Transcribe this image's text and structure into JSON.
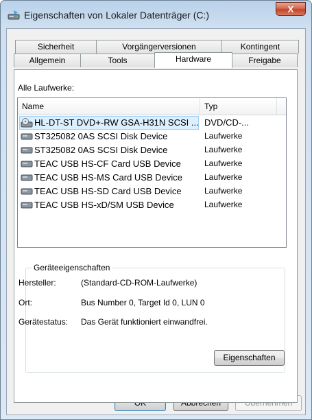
{
  "window": {
    "title": "Eigenschaften von Lokaler Datenträger (C:)",
    "close_label": "X"
  },
  "tabs_row1": [
    "Sicherheit",
    "Vorgängerversionen",
    "Kontingent"
  ],
  "tabs_row2": [
    "Allgemein",
    "Tools",
    "Hardware",
    "Freigabe"
  ],
  "active_tab": "Hardware",
  "drives_label": "Alle Laufwerke:",
  "list": {
    "columns": [
      "Name",
      "Typ"
    ],
    "rows": [
      {
        "name": "HL-DT-ST DVD+-RW GSA-H31N SCSI ...",
        "type": "DVD/CD-...",
        "icon": "dvd-drive-icon",
        "selected": true
      },
      {
        "name": "ST325082 0AS SCSI Disk Device",
        "type": "Laufwerke",
        "icon": "disk-drive-icon"
      },
      {
        "name": "ST325082 0AS SCSI Disk Device",
        "type": "Laufwerke",
        "icon": "disk-drive-icon"
      },
      {
        "name": "TEAC USB  HS-CF Card USB Device",
        "type": "Laufwerke",
        "icon": "disk-drive-icon"
      },
      {
        "name": "TEAC USB  HS-MS Card USB Device",
        "type": "Laufwerke",
        "icon": "disk-drive-icon"
      },
      {
        "name": "TEAC USB  HS-SD Card USB Device",
        "type": "Laufwerke",
        "icon": "disk-drive-icon"
      },
      {
        "name": "TEAC USB  HS-xD/SM USB Device",
        "type": "Laufwerke",
        "icon": "disk-drive-icon"
      }
    ]
  },
  "device_properties": {
    "group_title": "Geräteeigenschaften",
    "manufacturer_label": "Hersteller:",
    "manufacturer_value": "(Standard-CD-ROM-Laufwerke)",
    "location_label": "Ort:",
    "location_value": "Bus Number 0, Target Id 0, LUN 0",
    "status_label": "Gerätestatus:",
    "status_value": "Das Gerät funktioniert einwandfrei.",
    "properties_button": "Eigenschaften"
  },
  "buttons": {
    "ok": "OK",
    "cancel": "Abbrechen",
    "apply": "Übernehmen"
  },
  "colors": {
    "selection": "#cce8ff",
    "titlebar": "#b9d1ea",
    "close_button": "#c2432a"
  }
}
